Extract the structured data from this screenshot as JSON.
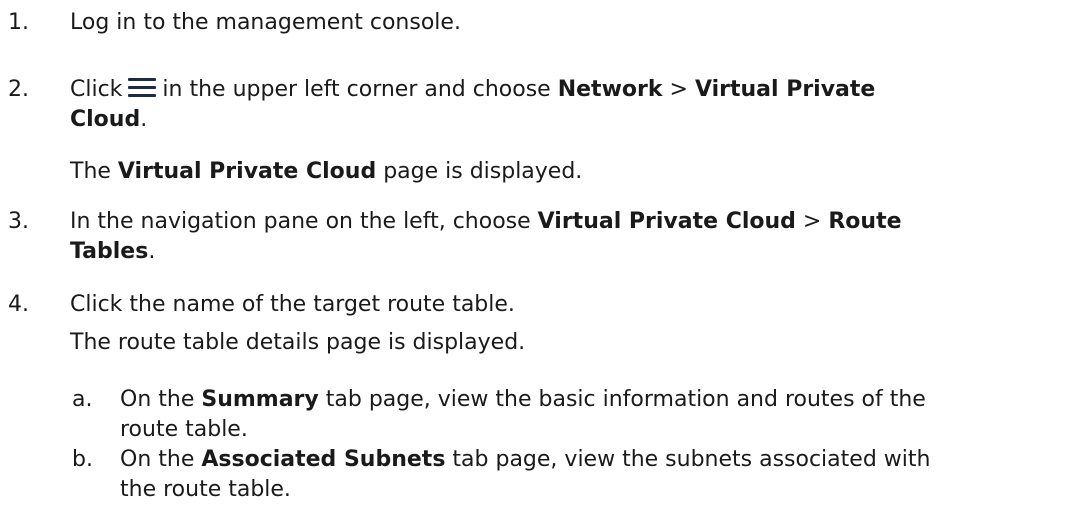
{
  "steps": [
    {
      "num": "1.",
      "text": "Log in to the management console."
    },
    {
      "num": "2.",
      "pre": "Click",
      "icon": "menu-icon",
      "mid": "in the upper left corner and choose",
      "b1": "Network",
      "sep": ">",
      "b2_line1": "Virtual Private",
      "b2_line2": "Cloud",
      "end": ".",
      "note_pre": "The",
      "note_bold": "Virtual Private Cloud",
      "note_post": "page is displayed."
    },
    {
      "num": "3.",
      "pre": "In the navigation pane on the left, choose",
      "b1": "Virtual Private Cloud",
      "sep": ">",
      "b2_line1": "Route",
      "b2_line2": "Tables",
      "end": "."
    },
    {
      "num": "4.",
      "text": "Click the name of the target route table.",
      "note": "The route table details page is displayed.",
      "substeps": [
        {
          "letter": "a.",
          "pre": "On the",
          "bold": "Summary",
          "line1_post": "tab page, view the basic information and routes of the",
          "line2": "route table."
        },
        {
          "letter": "b.",
          "pre": "On the",
          "bold": "Associated Subnets",
          "line1_post": "tab page, view the subnets associated with",
          "line2": "the route table."
        }
      ]
    }
  ]
}
